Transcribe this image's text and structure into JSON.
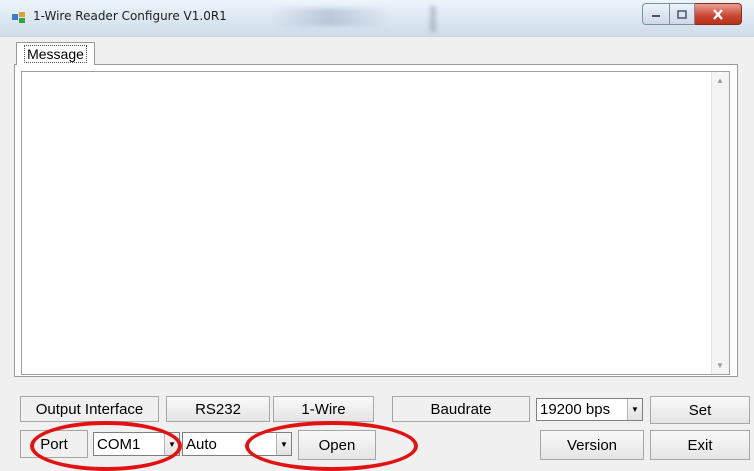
{
  "window": {
    "title": "1-Wire Reader Configure V1.0R1"
  },
  "tabs": [
    {
      "label": "Message"
    }
  ],
  "message_box": {
    "content": ""
  },
  "row1": {
    "output_interface_label": "Output Interface",
    "rs232_label": "RS232",
    "one_wire_label": "1-Wire",
    "baudrate_label": "Baudrate",
    "baudrate_value": "19200 bps",
    "set_label": "Set"
  },
  "row2": {
    "port_label": "Port",
    "port_value": "COM1",
    "mode_value": "Auto",
    "open_label": "Open",
    "version_label": "Version",
    "exit_label": "Exit"
  },
  "icons": {
    "app": "app-icon",
    "minimize": "minimize-icon",
    "maximize": "maximize-icon",
    "close": "close-icon"
  },
  "colors": {
    "annotation": "#e31212",
    "close_button": "#c9462f"
  }
}
